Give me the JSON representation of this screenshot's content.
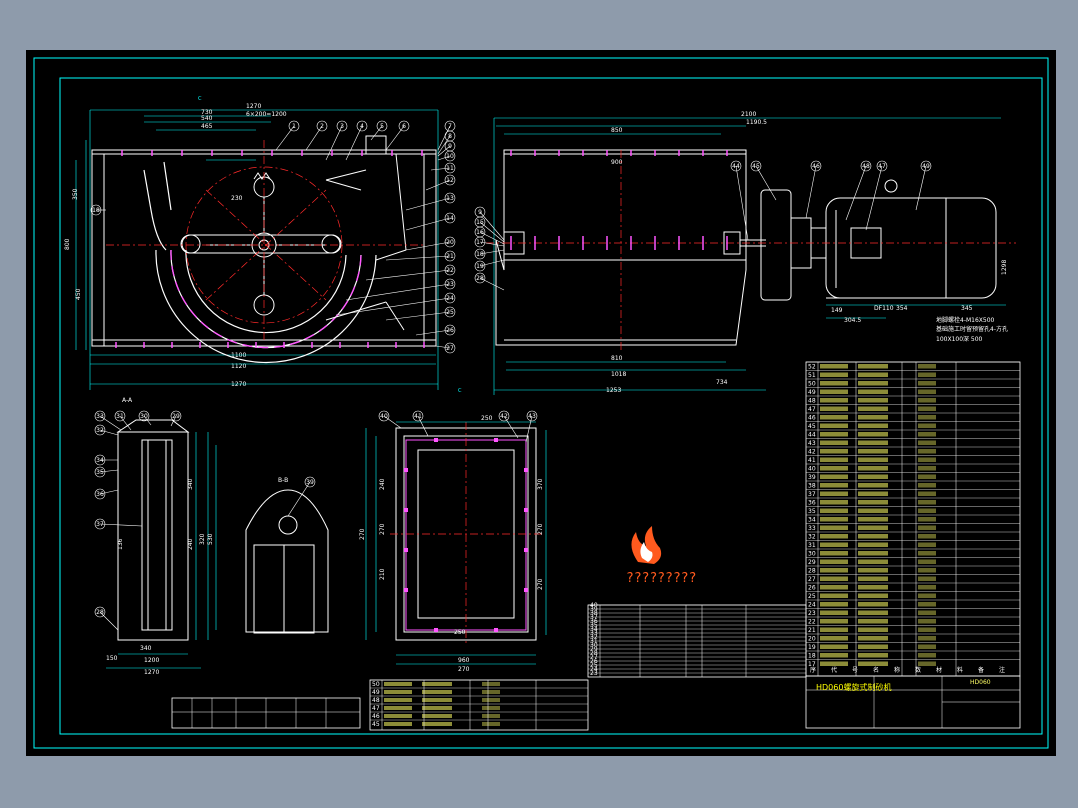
{
  "drawing": {
    "colors": {
      "background": "#8e9bab",
      "sheet": "#000000",
      "border": "#00ffff",
      "outline": "#ffffff",
      "centerline": "#ff2a2a",
      "part": "#ff55ff",
      "dimension": "#ffff66",
      "watermark": "#ff5a1e"
    },
    "section_labels": {
      "section_aa": "A-A",
      "section_bb": "B-B",
      "view_c": "C",
      "view_c2": "C"
    },
    "dims_front": [
      "1270",
      "730",
      "540",
      "465",
      "6×200=1200",
      "230",
      "350",
      "110",
      "1100",
      "1120",
      "1270",
      "800",
      "450",
      "350"
    ],
    "dims_side": [
      "2100",
      "1190.5",
      "850",
      "900",
      "810",
      "1018",
      "1253",
      "734",
      "149",
      "304.5",
      "DF110",
      "354",
      "345",
      "1298"
    ],
    "dims_aa": [
      "1200",
      "1270",
      "150",
      "320",
      "830",
      "530",
      "340",
      "240",
      "136"
    ],
    "dims_cview": [
      "250",
      "270",
      "370",
      "240",
      "270",
      "210",
      "270",
      "250",
      "460",
      "545",
      "960",
      "270",
      "270"
    ],
    "motor_note": {
      "line1": "地脚螺栓4-M16X500",
      "line2": "基础施工时留预留孔4-方孔",
      "line3": "100X100深 500"
    },
    "balloons_front": [
      "1",
      "2",
      "3",
      "4",
      "5",
      "6",
      "7",
      "8",
      "9",
      "10",
      "11",
      "12",
      "13",
      "14",
      "20",
      "21",
      "22",
      "23",
      "24",
      "25",
      "26",
      "27",
      "18"
    ],
    "balloons_side": [
      "44",
      "45",
      "46",
      "48",
      "47",
      "49",
      "9",
      "15",
      "16",
      "17",
      "18",
      "19",
      "28"
    ],
    "balloons_aa": [
      "33",
      "31",
      "30",
      "29",
      "32",
      "34",
      "35",
      "36",
      "37",
      "28",
      "39"
    ],
    "balloons_cview": [
      "40",
      "41",
      "42",
      "43"
    ],
    "watermark": {
      "line1": "??????????",
      "line2": "?????????"
    },
    "drawing_title": "HD060螺旋式制砂机",
    "drawing_code": "HD060",
    "bom_header": [
      "序",
      "代",
      "号",
      "名",
      "称",
      "数",
      "材",
      "料",
      "备",
      "注"
    ],
    "bom_right": [
      "52",
      "51",
      "50",
      "49",
      "48",
      "47",
      "46",
      "45",
      "44",
      "43",
      "42",
      "41",
      "40",
      "39",
      "38",
      "37",
      "36",
      "35",
      "34",
      "33",
      "32",
      "31",
      "30",
      "29",
      "28",
      "27",
      "26",
      "25",
      "24",
      "23",
      "22",
      "21",
      "20",
      "19",
      "18",
      "17"
    ],
    "bom_mid": [
      "40",
      "39",
      "38",
      "37",
      "36",
      "35",
      "34",
      "33",
      "32",
      "31",
      "30",
      "29",
      "28",
      "27",
      "26",
      "25",
      "24",
      "23"
    ],
    "bom_small": [
      "50",
      "49",
      "48",
      "47",
      "46",
      "45"
    ]
  }
}
